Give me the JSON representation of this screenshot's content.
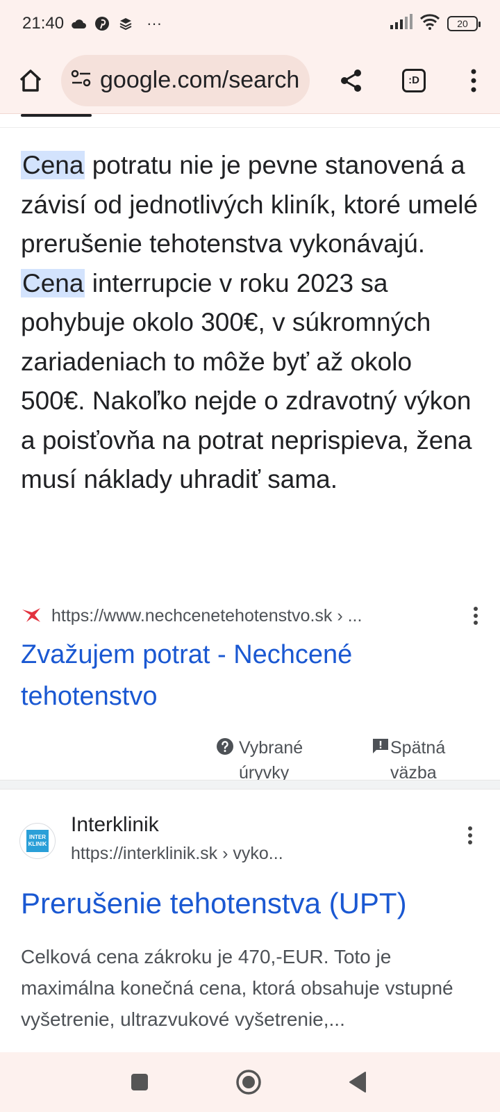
{
  "status_bar": {
    "time": "21:40",
    "icons": [
      "cloud-icon",
      "pinterest-icon",
      "layers-icon",
      "more-dots-icon"
    ],
    "more": "···",
    "battery": "20"
  },
  "browser": {
    "url": "google.com/search",
    "tabs_label": ":D"
  },
  "snippet": {
    "line1_highlight": "Cena",
    "line1_rest": " potratu nie je pevne stanovená a závisí od jednotlivých kliník, ktoré umelé prerušenie tehotenstva vykonávajú. ",
    "highlight2": "Cena",
    "rest": " interrupcie v roku 2023 sa pohybuje okolo 300€, v súkromných zariadeniach to môže byť až okolo 500€. Nakoľko nejde o zdravotný výkon a poisťovňa na potrat neprispieva, žena musí náklady uhradiť sama."
  },
  "result1": {
    "url": "https://www.nechcenetehotenstvo.sk › ...",
    "title": "Zvažujem potrat - Nechcené tehotenstvo"
  },
  "feedback": {
    "about_label": "Vybrané úryvky",
    "feedback_label": "Spätná väzba"
  },
  "result2": {
    "site_name": "Interklinik",
    "favicon_text": "INTER KLINIK",
    "url": "https://interklinik.sk › vyko...",
    "title": "Prerušenie tehotenstva (UPT)",
    "description": "Celková cena zákroku je 470,-EUR. Toto je maximálna konečná cena, ktorá obsahuje vstupné vyšetrenie, ultrazvukové vyšetrenie,..."
  },
  "colors": {
    "link": "#1a58d2",
    "highlight": "#d3e3fd",
    "chrome_bg": "#fdf1ee"
  }
}
